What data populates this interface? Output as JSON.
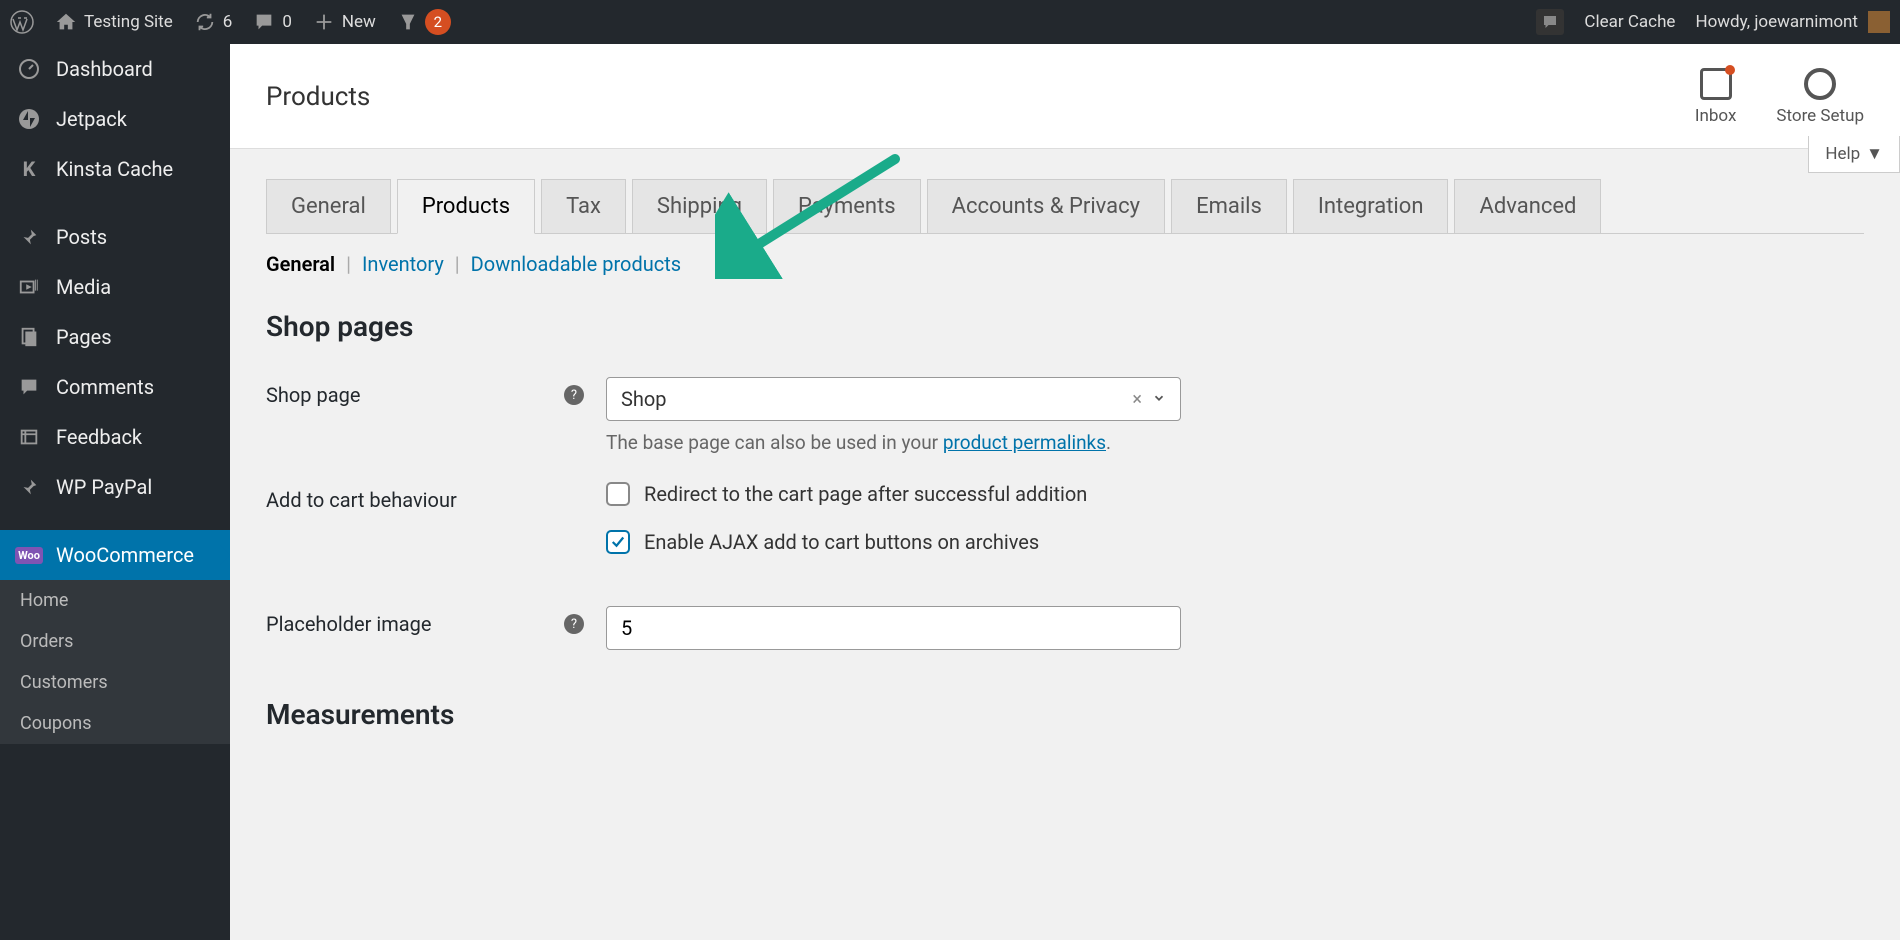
{
  "adminbar": {
    "site_name": "Testing Site",
    "refresh_count": "6",
    "comments_count": "0",
    "new_label": "New",
    "yoast_badge": "2",
    "clear_cache": "Clear Cache",
    "howdy_prefix": "Howdy, ",
    "username": "joewarnimont"
  },
  "sidebar": {
    "items": [
      {
        "label": "Dashboard",
        "icon": "dashboard"
      },
      {
        "label": "Jetpack",
        "icon": "jetpack"
      },
      {
        "label": "Kinsta Cache",
        "icon": "kinsta"
      },
      {
        "label": "Posts",
        "icon": "pin"
      },
      {
        "label": "Media",
        "icon": "media"
      },
      {
        "label": "Pages",
        "icon": "pages"
      },
      {
        "label": "Comments",
        "icon": "comment"
      },
      {
        "label": "Feedback",
        "icon": "feedback"
      },
      {
        "label": "WP PayPal",
        "icon": "pin"
      },
      {
        "label": "WooCommerce",
        "icon": "woo"
      }
    ],
    "submenu": [
      "Home",
      "Orders",
      "Customers",
      "Coupons"
    ]
  },
  "header": {
    "title": "Products",
    "inbox_label": "Inbox",
    "setup_label": "Store Setup",
    "help_label": "Help"
  },
  "tabs": [
    "General",
    "Products",
    "Tax",
    "Shipping",
    "Payments",
    "Accounts & Privacy",
    "Emails",
    "Integration",
    "Advanced"
  ],
  "active_tab_index": 1,
  "subtabs": [
    "General",
    "Inventory",
    "Downloadable products"
  ],
  "active_subtab_index": 0,
  "sections": {
    "shop_pages_heading": "Shop pages",
    "shop_page_label": "Shop page",
    "shop_page_value": "Shop",
    "shop_page_hint_prefix": "The base page can also be used in your ",
    "shop_page_hint_link": "product permalinks",
    "shop_page_hint_suffix": ".",
    "add_to_cart_label": "Add to cart behaviour",
    "cart_redirect_label": "Redirect to the cart page after successful addition",
    "cart_redirect_checked": false,
    "ajax_label": "Enable AJAX add to cart buttons on archives",
    "ajax_checked": true,
    "placeholder_label": "Placeholder image",
    "placeholder_value": "5",
    "measurements_heading": "Measurements"
  }
}
